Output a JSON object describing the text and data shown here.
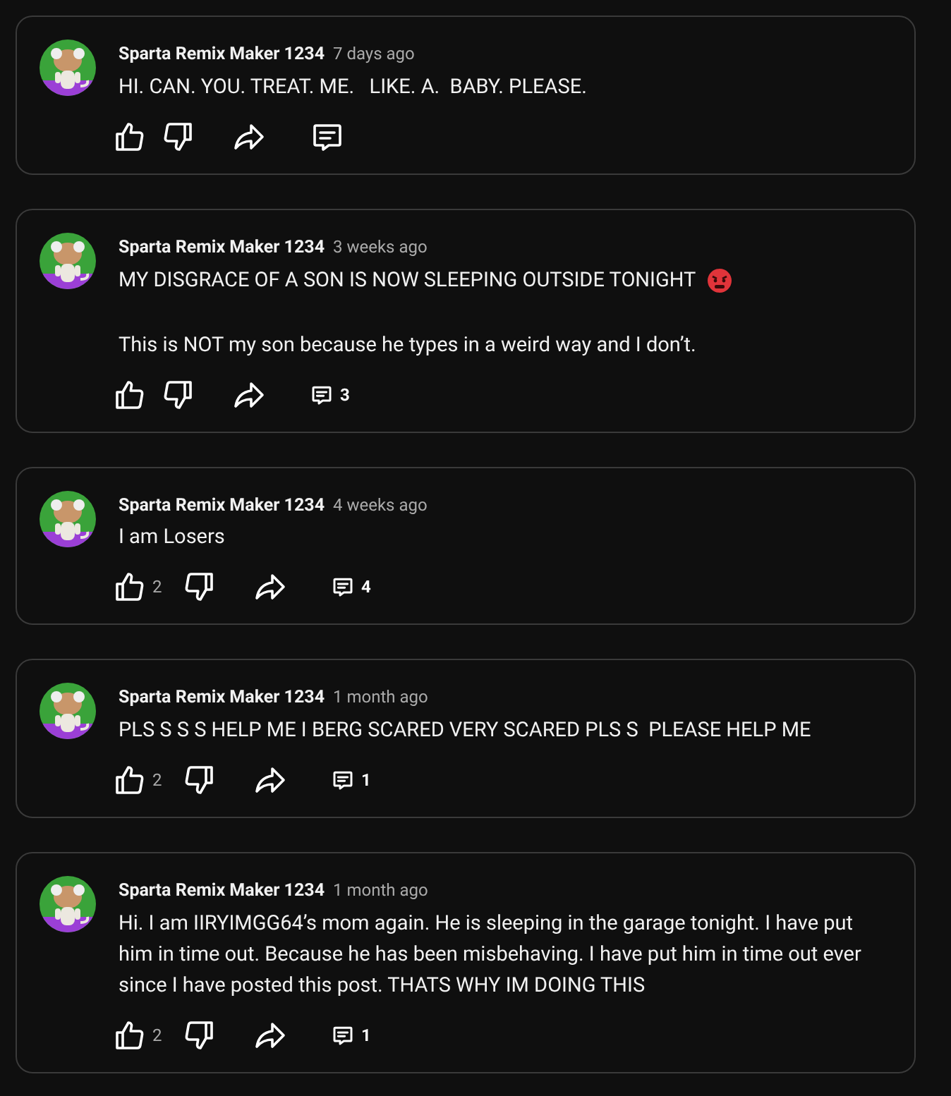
{
  "comments": [
    {
      "author": "Sparta Remix Maker 1234",
      "time": "7 days ago",
      "paragraphs": [
        {
          "text": "HI. CAN. YOU. TREAT. ME.   LIKE. A.  BABY. PLEASE."
        }
      ]
    },
    {
      "author": "Sparta Remix Maker 1234",
      "time": "3 weeks ago",
      "paragraphs": [
        {
          "text": "MY DISGRACE OF A SON IS NOW SLEEPING OUTSIDE TONIGHT",
          "angry_emoji": true
        },
        {
          "text": "This is NOT my son because he types in a weird way and I don’t."
        }
      ],
      "replies": "3"
    },
    {
      "author": "Sparta Remix Maker 1234",
      "time": "4 weeks ago",
      "paragraphs": [
        {
          "text": "I am Losers"
        }
      ],
      "likes": "2",
      "replies": "4"
    },
    {
      "author": "Sparta Remix Maker 1234",
      "time": "1 month ago",
      "paragraphs": [
        {
          "text": "PLS S S S HELP ME I BERG SCARED VERY SCARED PLS S  PLEASE HELP ME"
        }
      ],
      "likes": "2",
      "replies": "1"
    },
    {
      "author": "Sparta Remix Maker 1234",
      "time": "1 month ago",
      "paragraphs": [
        {
          "text": "Hi. I am IIRYIMGG64’s mom again. He is sleeping in the garage tonight. I have put him in time out. Because he has been misbehaving. I have put him in time out ever since I have posted this post. THATS WHY IM DOING THIS"
        }
      ],
      "likes": "2",
      "replies": "1"
    }
  ]
}
